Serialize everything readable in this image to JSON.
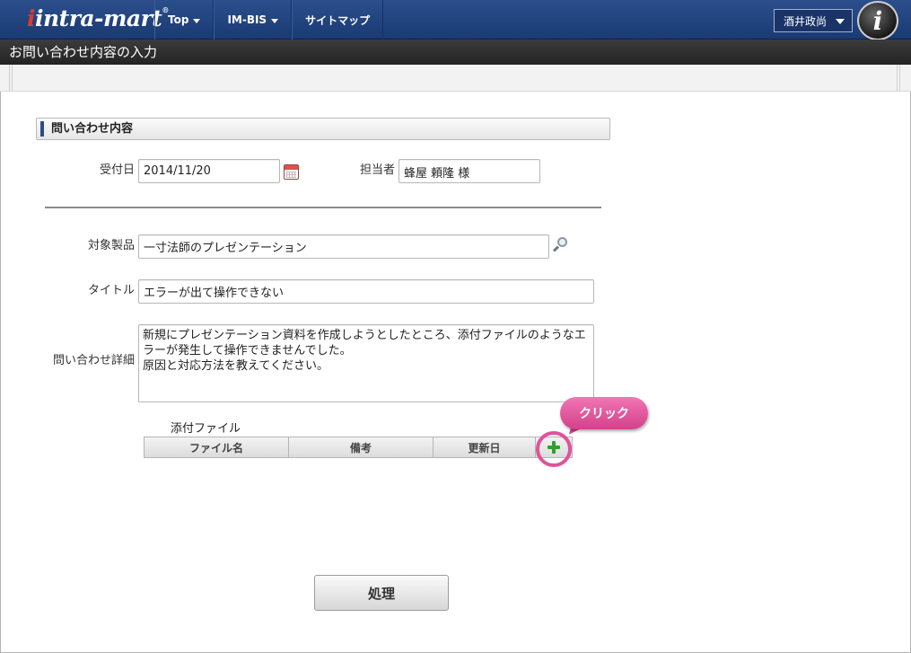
{
  "header": {
    "logo_text": "intra-mart",
    "logo_mark": "®",
    "nav": [
      {
        "label": "Top"
      },
      {
        "label": "IM-BIS"
      },
      {
        "label": "サイトマップ"
      }
    ],
    "user_name": "酒井政尚",
    "app_icon_letter": "i"
  },
  "page_title": "お問い合わせ内容の入力",
  "section_title": "問い合わせ内容",
  "form": {
    "received_date_label": "受付日",
    "received_date_value": "2014/11/20",
    "assignee_label": "担当者",
    "assignee_value": "蜂屋 頼隆 様",
    "product_label": "対象製品",
    "product_value": "一寸法師のプレゼンテーション",
    "title_label": "タイトル",
    "title_value": "エラーが出て操作できない",
    "details_label": "問い合わせ詳細",
    "details_value": "新規にプレゼンテーション資料を作成しようとしたところ、添付ファイルのようなエラーが発生して操作できませんでした。\n原因と対応方法を教えてください。"
  },
  "attachments": {
    "label": "添付ファイル",
    "columns": [
      "ファイル名",
      "備考",
      "更新日"
    ]
  },
  "callout_text": "クリック",
  "submit_label": "処理",
  "colors": {
    "header_blue": "#1f417c",
    "title_dark": "#2e2e2e",
    "accent_pink": "#e0529a",
    "add_green": "#2fa12c"
  }
}
